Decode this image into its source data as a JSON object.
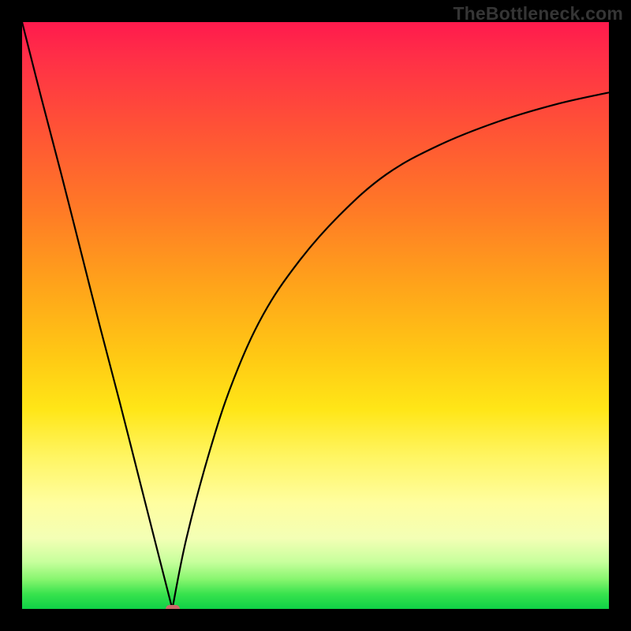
{
  "watermark": "TheBottleneck.com",
  "chart_data": {
    "type": "line",
    "title": "",
    "xlabel": "",
    "ylabel": "",
    "xlim": [
      0,
      100
    ],
    "ylim": [
      0,
      100
    ],
    "grid": false,
    "legend": false,
    "annotations": [],
    "series": [
      {
        "name": "left-branch",
        "x": [
          0,
          3.3,
          6.7,
          10,
          13.3,
          16.7,
          20,
          23.3,
          25.6
        ],
        "y": [
          100,
          87,
          74,
          61,
          48,
          35,
          22,
          9,
          0
        ]
      },
      {
        "name": "right-branch",
        "x": [
          25.6,
          28,
          32,
          36,
          41,
          47,
          54,
          62,
          71,
          81,
          91,
          100
        ],
        "y": [
          0,
          12,
          27,
          39,
          50,
          59,
          67,
          74,
          79,
          83,
          86,
          88
        ]
      }
    ],
    "marker": {
      "x": 25.6,
      "y": 0
    },
    "gradient_stops": [
      {
        "pos": 0,
        "color": "#ff1a4d"
      },
      {
        "pos": 50,
        "color": "#ffc914"
      },
      {
        "pos": 88,
        "color": "#f3ffb5"
      },
      {
        "pos": 100,
        "color": "#0fd146"
      }
    ]
  }
}
